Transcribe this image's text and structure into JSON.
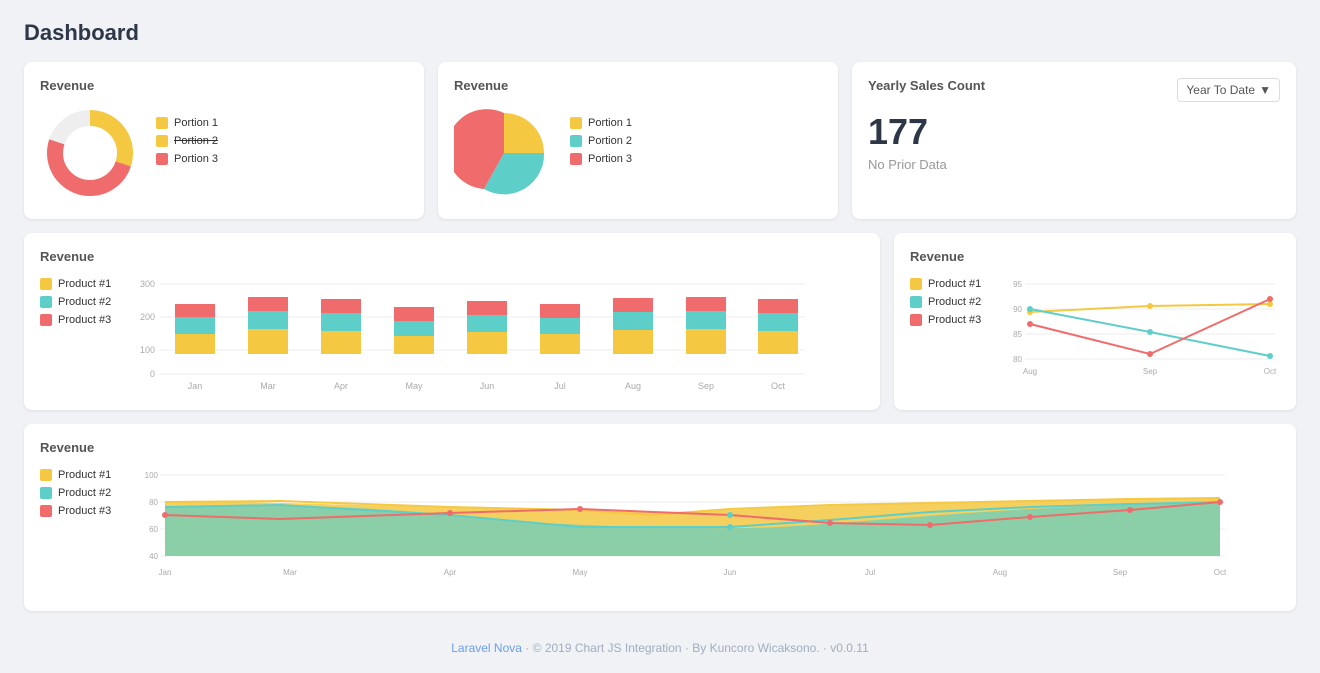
{
  "page": {
    "title": "Dashboard"
  },
  "donut_card": {
    "title": "Revenue",
    "legend": [
      {
        "label": "Portion 1",
        "color": "#f5c842"
      },
      {
        "label": "Portion 2",
        "color": "#f5c842",
        "strike": true
      },
      {
        "label": "Portion 3",
        "color": "#f06b6b"
      }
    ]
  },
  "pie_card": {
    "title": "Revenue",
    "legend": [
      {
        "label": "Portion 1",
        "color": "#f5c842"
      },
      {
        "label": "Portion 2",
        "color": "#5ecec8"
      },
      {
        "label": "Portion 3",
        "color": "#f06b6b"
      }
    ]
  },
  "stats_card": {
    "title": "Yearly Sales Count",
    "value": "177",
    "sub": "No Prior Data",
    "dropdown_label": "Year To Date"
  },
  "bar_card": {
    "title": "Revenue",
    "legend": [
      {
        "label": "Product #1",
        "color": "#f5c842"
      },
      {
        "label": "Product #2",
        "color": "#5ecec8"
      },
      {
        "label": "Product #3",
        "color": "#f06b6b"
      }
    ],
    "months": [
      "Jan",
      "Mar",
      "Apr",
      "May",
      "Jun",
      "Jul",
      "Aug",
      "Sep",
      "Oct"
    ],
    "y_labels": [
      "0",
      "100",
      "200",
      "300"
    ]
  },
  "line_small_card": {
    "title": "Revenue",
    "legend": [
      {
        "label": "Product #1",
        "color": "#f5c842"
      },
      {
        "label": "Product #2",
        "color": "#5ecec8"
      },
      {
        "label": "Product #3",
        "color": "#f06b6b"
      }
    ],
    "x_labels": [
      "Aug",
      "Sep",
      "Oct"
    ],
    "y_labels": [
      "80",
      "85",
      "90",
      "95"
    ]
  },
  "area_card": {
    "title": "Revenue",
    "legend": [
      {
        "label": "Product #1",
        "color": "#f5c842"
      },
      {
        "label": "Product #2",
        "color": "#5ecec8"
      },
      {
        "label": "Product #3",
        "color": "#f06b6b"
      }
    ],
    "x_labels": [
      "Jan",
      "Mar",
      "Apr",
      "May",
      "Jun",
      "Jul",
      "Aug",
      "Sep",
      "Oct"
    ],
    "y_labels": [
      "40",
      "60",
      "80",
      "100"
    ]
  },
  "footer": {
    "link_text": "Laravel Nova",
    "copy": "© 2019 Chart JS Integration · By Kuncoro Wicaksono. · v0.0.11"
  }
}
